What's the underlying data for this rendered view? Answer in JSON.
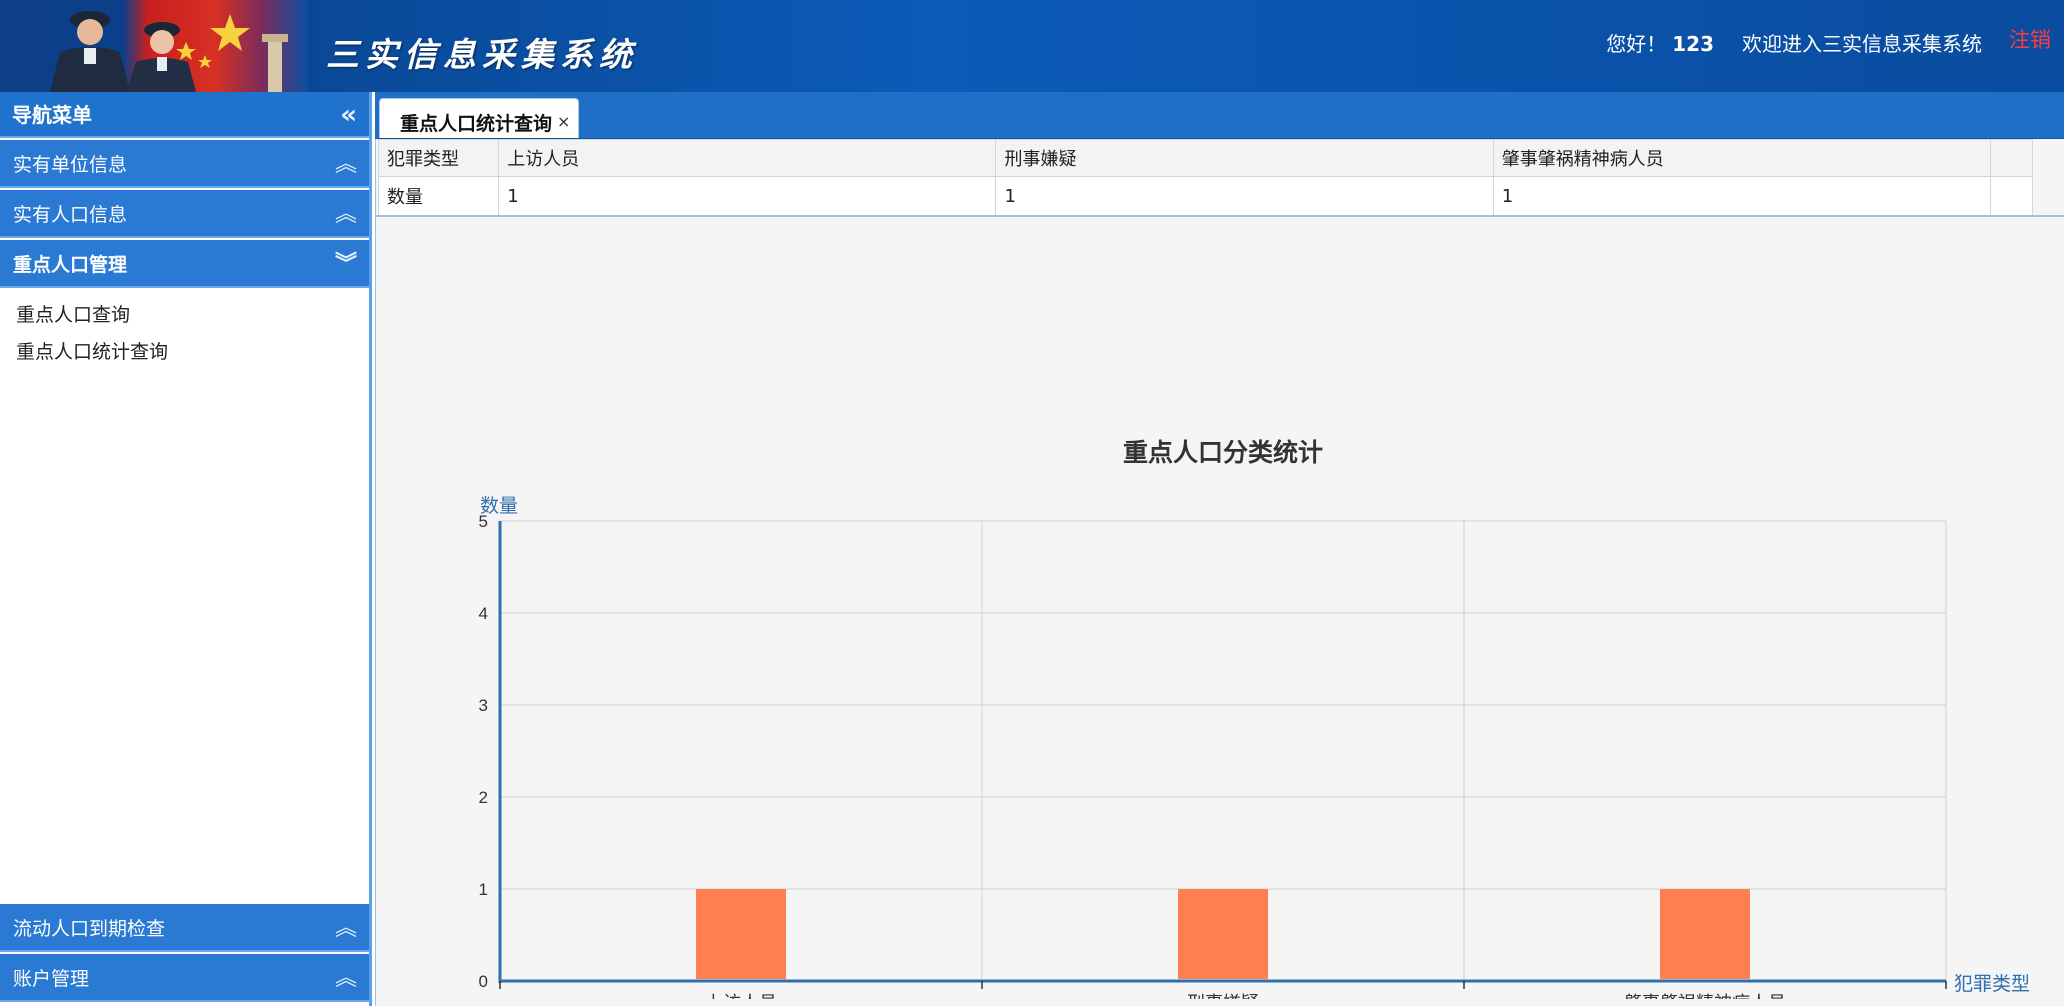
{
  "header": {
    "app_title": "三实信息采集系统",
    "greeting": "您好！",
    "username": "123",
    "welcome": "欢迎进入三实信息采集系统",
    "logout": "注销"
  },
  "sidebar": {
    "title": "导航菜单",
    "collapse_icon": "«",
    "panels": [
      {
        "label": "实有单位信息",
        "icon": "chevrons-up-icon"
      },
      {
        "label": "实有人口信息",
        "icon": "chevrons-up-icon"
      },
      {
        "label": "重点人口管理",
        "icon": "chevrons-down-icon",
        "items": [
          "重点人口查询",
          "重点人口统计查询"
        ]
      },
      {
        "label": "流动人口到期检查",
        "icon": "chevrons-up-icon"
      },
      {
        "label": "账户管理",
        "icon": "chevrons-up-icon"
      }
    ]
  },
  "tabs": [
    {
      "label": "重点人口统计查询",
      "close": "×"
    }
  ],
  "table": {
    "headers": [
      "犯罪类型",
      "上访人员",
      "刑事嫌疑",
      "肇事肇祸精神病人员"
    ],
    "row": [
      "数量",
      "1",
      "1",
      "1"
    ]
  },
  "chart_data": {
    "type": "bar",
    "title": "重点人口分类统计",
    "ylabel": "数量",
    "xlabel": "犯罪类型",
    "categories": [
      "上访人员",
      "刑事嫌疑",
      "肇事肇祸精神病人员"
    ],
    "values": [
      1,
      1,
      1
    ],
    "ylim": [
      0,
      5
    ],
    "yticks": [
      0,
      1,
      2,
      3,
      4,
      5
    ],
    "grid": true,
    "bar_color": "#ff7f50",
    "axis_color": "#2f6fb0",
    "grid_color": "#d0d0d0"
  },
  "colors": {
    "header_blue": "#0b5bb8",
    "sidebar_blue": "#2a7ad4",
    "logout_red": "#ff3b3b"
  }
}
